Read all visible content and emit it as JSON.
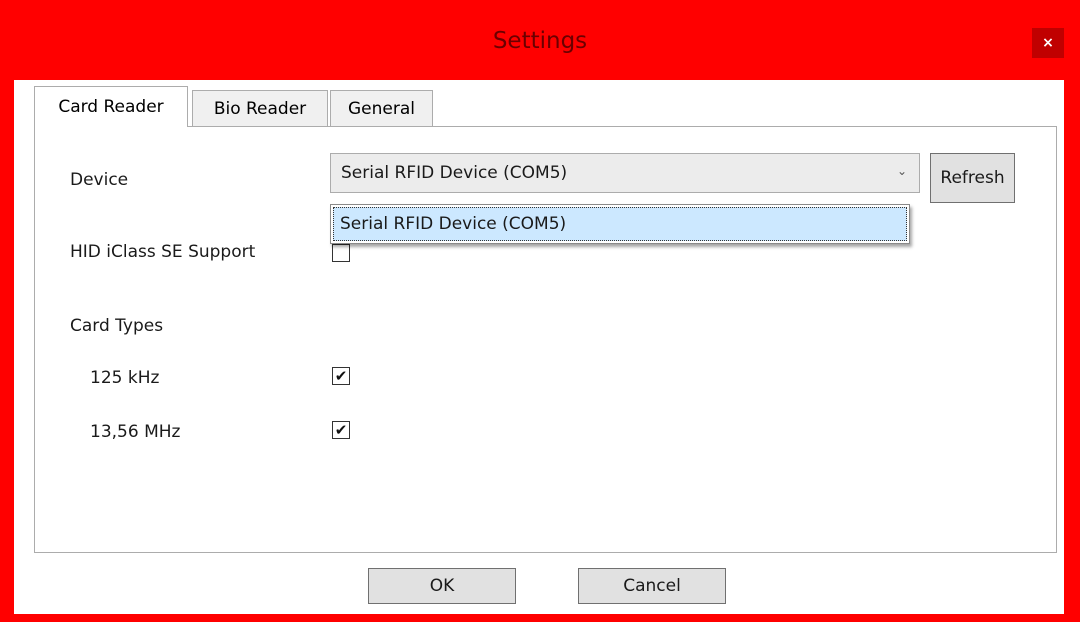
{
  "window": {
    "title": "Settings",
    "close_glyph": "×",
    "frame_color": "#ff0000"
  },
  "tabs": [
    {
      "label": "Card Reader",
      "active": true
    },
    {
      "label": "Bio Reader",
      "active": false
    },
    {
      "label": "General",
      "active": false
    }
  ],
  "card_reader": {
    "device_label": "Device",
    "device_selected": "Serial RFID Device (COM5)",
    "device_options": [
      "Serial RFID Device (COM5)"
    ],
    "dropdown_arrow": "⌄",
    "refresh_label": "Refresh",
    "hid_label": "HID iClass SE Support",
    "hid_checked": false,
    "card_types_label": "Card Types",
    "card_types": [
      {
        "label": "125 kHz",
        "checked": true
      },
      {
        "label": "13,56 MHz",
        "checked": true
      }
    ]
  },
  "footer": {
    "ok_label": "OK",
    "cancel_label": "Cancel"
  },
  "check_glyph": "✔",
  "highlight_color": "#cce8ff"
}
